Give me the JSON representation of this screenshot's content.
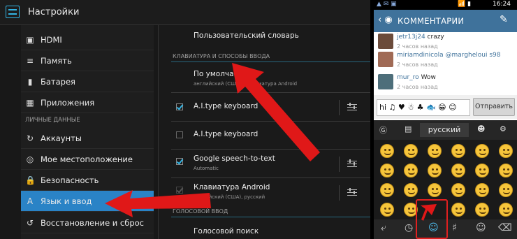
{
  "settings": {
    "title": "Настройки",
    "sidebar": [
      {
        "icon": "hdmi-icon",
        "glyph": "▣",
        "label": "HDMI"
      },
      {
        "icon": "storage-icon",
        "glyph": "≡",
        "label": "Память"
      },
      {
        "icon": "battery-icon",
        "glyph": "▮",
        "label": "Батарея"
      },
      {
        "icon": "apps-icon",
        "glyph": "▦",
        "label": "Приложения"
      },
      {
        "icon": "accounts-icon",
        "glyph": "↻",
        "label": "Аккаунты"
      },
      {
        "icon": "location-icon",
        "glyph": "◎",
        "label": "Мое местоположение"
      },
      {
        "icon": "lock-icon",
        "glyph": "🔒",
        "label": "Безопасность"
      },
      {
        "icon": "language-icon",
        "glyph": "A",
        "label": "Язык и ввод"
      },
      {
        "icon": "backup-icon",
        "glyph": "↺",
        "label": "Восстановление и сброс"
      }
    ],
    "personal_header": "ЛИЧНЫЕ ДАННЫЕ",
    "content": {
      "user_dictionary": "Пользовательский словарь",
      "keyboard_header": "КЛАВИАТУРА И СПОСОБЫ ВВОДА",
      "default_title": "По умолчанию",
      "default_sub": "английский (США) - Клавиатура Android",
      "items": [
        {
          "title": "A.I.type keyboard",
          "sub": "",
          "checked": true
        },
        {
          "title": "A.I.type keyboard",
          "sub": "",
          "checked": false
        },
        {
          "title": "Google speech-to-text",
          "sub": "Automatic",
          "checked": true
        },
        {
          "title": "Клавиатура Android",
          "sub": "английский (США), русский",
          "checked": true
        }
      ],
      "voice_header": "ГОЛОСОВОЙ ВВОД",
      "voice_search": "Голосовой поиск"
    }
  },
  "instagram": {
    "status_time": "16:24",
    "title": "КОММЕНТАРИИ",
    "comments": [
      {
        "user": "jetr13j24",
        "text": "crazy",
        "time": "2 часов назад"
      },
      {
        "user": "miriamdinicola",
        "text": "@margheloui s98",
        "time": "2 часов назад"
      },
      {
        "user": "mur_ro",
        "text": "Wow",
        "time": "2 часов назад"
      }
    ],
    "input_value": "hi ♫ ♥ ☃ ♣ 🐟 😁 😊",
    "send_label": "Отправить",
    "keyboard_lang": "русский"
  }
}
